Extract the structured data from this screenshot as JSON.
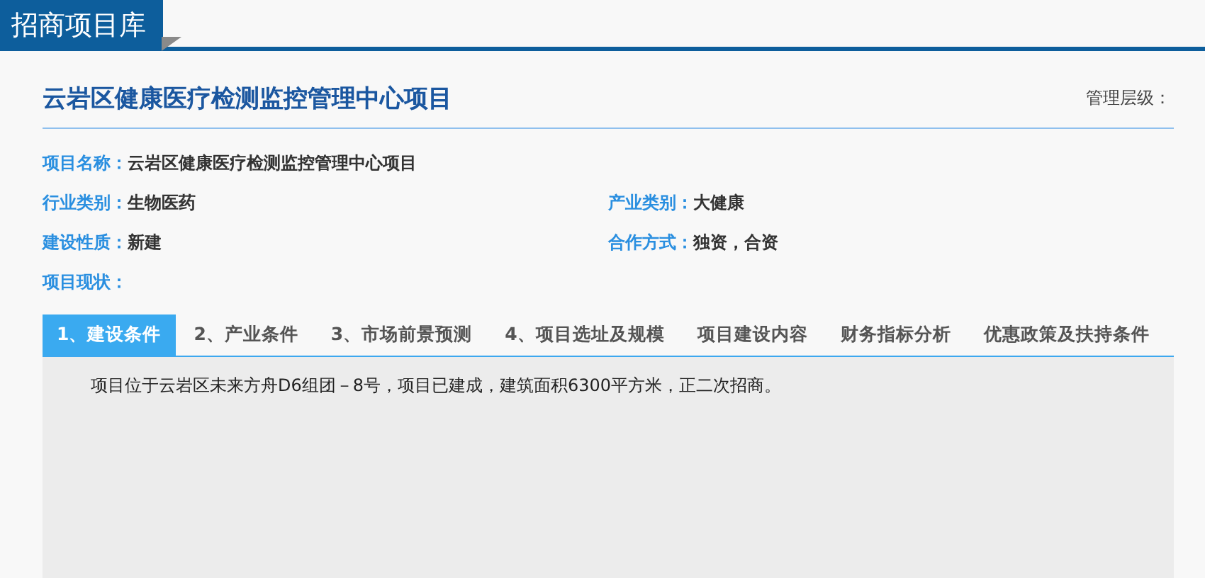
{
  "header": {
    "title": "招商项目库"
  },
  "project": {
    "title": "云岩区健康医疗检测监控管理中心项目",
    "level_label": "管理层级："
  },
  "fields": [
    [
      {
        "label": "项目名称：",
        "value": "云岩区健康医疗检测监控管理中心项目"
      }
    ],
    [
      {
        "label": "行业类别：",
        "value": "生物医药"
      },
      {
        "label": "产业类别：",
        "value": "大健康"
      }
    ],
    [
      {
        "label": "建设性质：",
        "value": "新建"
      },
      {
        "label": "合作方式：",
        "value": "独资，合资"
      }
    ],
    [
      {
        "label": "项目现状："
      }
    ]
  ],
  "tabs": [
    {
      "label": "1、建设条件",
      "selected": true
    },
    {
      "label": "2、产业条件",
      "selected": false
    },
    {
      "label": "3、市场前景预测",
      "selected": false
    },
    {
      "label": "4、项目选址及规模",
      "selected": false
    },
    {
      "label": "项目建设内容",
      "selected": false
    },
    {
      "label": "财务指标分析",
      "selected": false
    },
    {
      "label": "优惠政策及扶持条件",
      "selected": false
    }
  ],
  "content": "项目位于云岩区未来方舟D6组团－8号，项目已建成，建筑面积6300平方米，正二次招商。"
}
